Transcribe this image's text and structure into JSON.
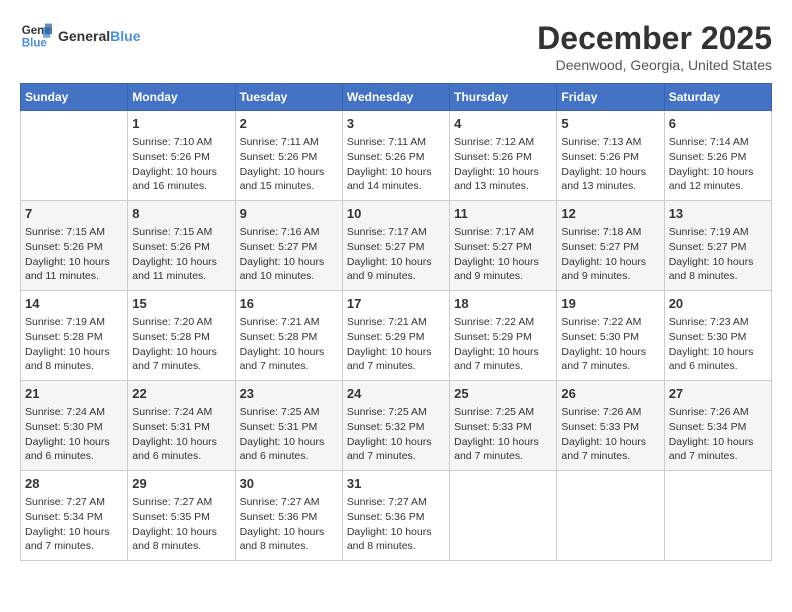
{
  "header": {
    "logo_line1": "General",
    "logo_line2": "Blue",
    "month": "December 2025",
    "location": "Deenwood, Georgia, United States"
  },
  "days_of_week": [
    "Sunday",
    "Monday",
    "Tuesday",
    "Wednesday",
    "Thursday",
    "Friday",
    "Saturday"
  ],
  "weeks": [
    [
      {
        "day": "",
        "info": ""
      },
      {
        "day": "1",
        "info": "Sunrise: 7:10 AM\nSunset: 5:26 PM\nDaylight: 10 hours\nand 16 minutes."
      },
      {
        "day": "2",
        "info": "Sunrise: 7:11 AM\nSunset: 5:26 PM\nDaylight: 10 hours\nand 15 minutes."
      },
      {
        "day": "3",
        "info": "Sunrise: 7:11 AM\nSunset: 5:26 PM\nDaylight: 10 hours\nand 14 minutes."
      },
      {
        "day": "4",
        "info": "Sunrise: 7:12 AM\nSunset: 5:26 PM\nDaylight: 10 hours\nand 13 minutes."
      },
      {
        "day": "5",
        "info": "Sunrise: 7:13 AM\nSunset: 5:26 PM\nDaylight: 10 hours\nand 13 minutes."
      },
      {
        "day": "6",
        "info": "Sunrise: 7:14 AM\nSunset: 5:26 PM\nDaylight: 10 hours\nand 12 minutes."
      }
    ],
    [
      {
        "day": "7",
        "info": "Sunrise: 7:15 AM\nSunset: 5:26 PM\nDaylight: 10 hours\nand 11 minutes."
      },
      {
        "day": "8",
        "info": "Sunrise: 7:15 AM\nSunset: 5:26 PM\nDaylight: 10 hours\nand 11 minutes."
      },
      {
        "day": "9",
        "info": "Sunrise: 7:16 AM\nSunset: 5:27 PM\nDaylight: 10 hours\nand 10 minutes."
      },
      {
        "day": "10",
        "info": "Sunrise: 7:17 AM\nSunset: 5:27 PM\nDaylight: 10 hours\nand 9 minutes."
      },
      {
        "day": "11",
        "info": "Sunrise: 7:17 AM\nSunset: 5:27 PM\nDaylight: 10 hours\nand 9 minutes."
      },
      {
        "day": "12",
        "info": "Sunrise: 7:18 AM\nSunset: 5:27 PM\nDaylight: 10 hours\nand 9 minutes."
      },
      {
        "day": "13",
        "info": "Sunrise: 7:19 AM\nSunset: 5:27 PM\nDaylight: 10 hours\nand 8 minutes."
      }
    ],
    [
      {
        "day": "14",
        "info": "Sunrise: 7:19 AM\nSunset: 5:28 PM\nDaylight: 10 hours\nand 8 minutes."
      },
      {
        "day": "15",
        "info": "Sunrise: 7:20 AM\nSunset: 5:28 PM\nDaylight: 10 hours\nand 7 minutes."
      },
      {
        "day": "16",
        "info": "Sunrise: 7:21 AM\nSunset: 5:28 PM\nDaylight: 10 hours\nand 7 minutes."
      },
      {
        "day": "17",
        "info": "Sunrise: 7:21 AM\nSunset: 5:29 PM\nDaylight: 10 hours\nand 7 minutes."
      },
      {
        "day": "18",
        "info": "Sunrise: 7:22 AM\nSunset: 5:29 PM\nDaylight: 10 hours\nand 7 minutes."
      },
      {
        "day": "19",
        "info": "Sunrise: 7:22 AM\nSunset: 5:30 PM\nDaylight: 10 hours\nand 7 minutes."
      },
      {
        "day": "20",
        "info": "Sunrise: 7:23 AM\nSunset: 5:30 PM\nDaylight: 10 hours\nand 6 minutes."
      }
    ],
    [
      {
        "day": "21",
        "info": "Sunrise: 7:24 AM\nSunset: 5:30 PM\nDaylight: 10 hours\nand 6 minutes."
      },
      {
        "day": "22",
        "info": "Sunrise: 7:24 AM\nSunset: 5:31 PM\nDaylight: 10 hours\nand 6 minutes."
      },
      {
        "day": "23",
        "info": "Sunrise: 7:25 AM\nSunset: 5:31 PM\nDaylight: 10 hours\nand 6 minutes."
      },
      {
        "day": "24",
        "info": "Sunrise: 7:25 AM\nSunset: 5:32 PM\nDaylight: 10 hours\nand 7 minutes."
      },
      {
        "day": "25",
        "info": "Sunrise: 7:25 AM\nSunset: 5:33 PM\nDaylight: 10 hours\nand 7 minutes."
      },
      {
        "day": "26",
        "info": "Sunrise: 7:26 AM\nSunset: 5:33 PM\nDaylight: 10 hours\nand 7 minutes."
      },
      {
        "day": "27",
        "info": "Sunrise: 7:26 AM\nSunset: 5:34 PM\nDaylight: 10 hours\nand 7 minutes."
      }
    ],
    [
      {
        "day": "28",
        "info": "Sunrise: 7:27 AM\nSunset: 5:34 PM\nDaylight: 10 hours\nand 7 minutes."
      },
      {
        "day": "29",
        "info": "Sunrise: 7:27 AM\nSunset: 5:35 PM\nDaylight: 10 hours\nand 8 minutes."
      },
      {
        "day": "30",
        "info": "Sunrise: 7:27 AM\nSunset: 5:36 PM\nDaylight: 10 hours\nand 8 minutes."
      },
      {
        "day": "31",
        "info": "Sunrise: 7:27 AM\nSunset: 5:36 PM\nDaylight: 10 hours\nand 8 minutes."
      },
      {
        "day": "",
        "info": ""
      },
      {
        "day": "",
        "info": ""
      },
      {
        "day": "",
        "info": ""
      }
    ]
  ]
}
